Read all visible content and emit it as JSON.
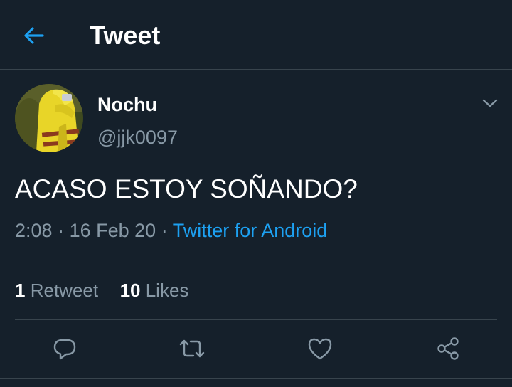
{
  "header": {
    "title": "Tweet",
    "back_icon": "arrow-left-icon",
    "accent_color": "#1da1f2"
  },
  "tweet": {
    "author": {
      "display_name": "Nochu",
      "username": "@jjk0097",
      "avatar_icon": "profile-photo"
    },
    "text": "ACASO ESTOY SOÑANDO?",
    "time": "2:08",
    "date": "16 Feb 20",
    "separator": "·",
    "source": "Twitter for Android",
    "caret_icon": "chevron-down-icon"
  },
  "stats": {
    "retweets_count": "1",
    "retweets_label": "Retweet",
    "likes_count": "10",
    "likes_label": "Likes"
  },
  "actions": [
    {
      "icon": "reply-icon"
    },
    {
      "icon": "retweet-icon"
    },
    {
      "icon": "like-icon"
    },
    {
      "icon": "share-icon"
    }
  ],
  "colors": {
    "background": "#15202b",
    "border": "#38444d",
    "secondary_text": "#8899a6",
    "link": "#1da1f2"
  }
}
